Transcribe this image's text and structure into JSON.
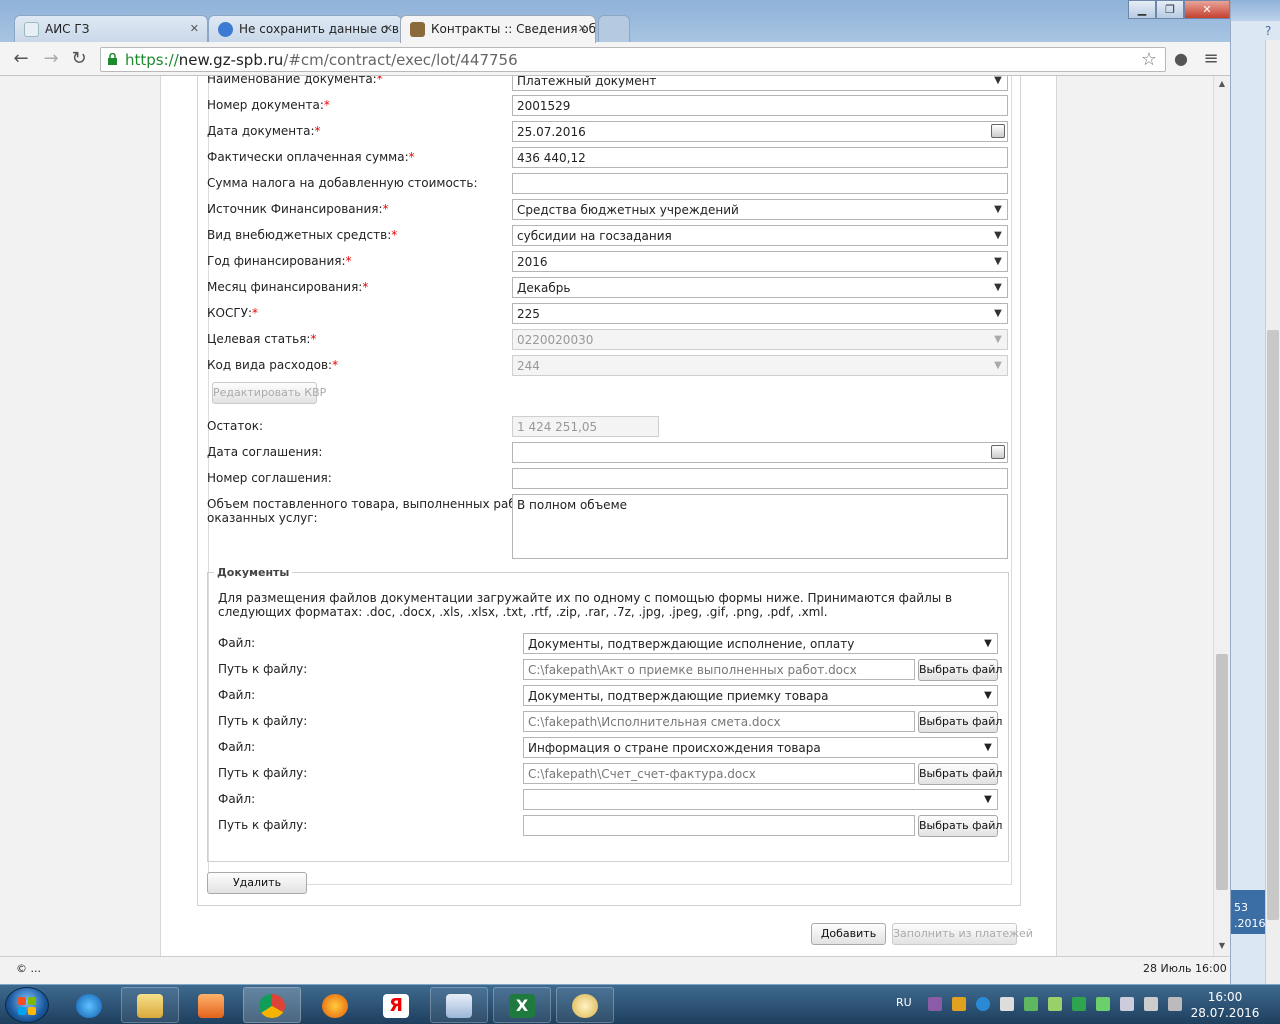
{
  "browser": {
    "tabs": [
      {
        "title": "АИС ГЗ",
        "active": false
      },
      {
        "title": "Не сохранить данные о выб",
        "active": false
      },
      {
        "title": "Контракты :: Сведения об и",
        "active": true
      }
    ],
    "url_secure": "https://",
    "url_host": "new.gz-spb.ru",
    "url_path": "/#cm/contract/exec/lot/447756"
  },
  "form": {
    "doc_name": {
      "label": "Наименование документа:",
      "value": "Платежный документ"
    },
    "doc_number": {
      "label": "Номер документа:",
      "value": "2001529"
    },
    "doc_date": {
      "label": "Дата документа:",
      "value": "25.07.2016"
    },
    "paid_sum": {
      "label": "Фактически оплаченная сумма:",
      "value": "436 440,12"
    },
    "vat_sum": {
      "label": "Сумма налога на добавленную стоимость:",
      "value": ""
    },
    "fin_source": {
      "label": "Источник Финансирования:",
      "value": "Средства бюджетных учреждений"
    },
    "extra_funds": {
      "label": "Вид внебюджетных средств:",
      "value": "субсидии на госзадания"
    },
    "fin_year": {
      "label": "Год финансирования:",
      "value": "2016"
    },
    "fin_month": {
      "label": "Месяц финансирования:",
      "value": "Декабрь"
    },
    "kosgu": {
      "label": "КОСГУ:",
      "value": "225"
    },
    "target_article": {
      "label": "Целевая статья:",
      "value": "0220020030"
    },
    "expense_code": {
      "label": "Код вида расходов:",
      "value": "244"
    },
    "edit_kvr": "Редактировать КВР",
    "remainder": {
      "label": "Остаток:",
      "value": "1 424 251,05"
    },
    "agreement_date": {
      "label": "Дата соглашения:",
      "value": ""
    },
    "agreement_number": {
      "label": "Номер соглашения:",
      "value": ""
    },
    "volume": {
      "label_line1": "Объем поставленного товара, выполненных работ,",
      "label_line2": "оказанных услуг:",
      "value": "В полном объеме"
    },
    "req_mark": "*"
  },
  "documents": {
    "legend": "Документы",
    "note": "Для размещения файлов документации загружайте их по одному с помощью формы ниже. Принимаются файлы в следующих форматах: .doc, .docx, .xls, .xlsx, .txt, .rtf, .zip, .rar, .7z, .jpg, .jpeg, .gif, .png, .pdf, .xml.",
    "file_label": "Файл:",
    "path_label": "Путь к файлу:",
    "choose_label": "Выбрать файл",
    "rows": [
      {
        "type": "Документы, подтверждающие исполнение, оплату",
        "path": "C:\\fakepath\\Акт о приемке выполненных работ.docx"
      },
      {
        "type": "Документы, подтверждающие приемку товара",
        "path": "C:\\fakepath\\Исполнительная смета.docx"
      },
      {
        "type": "Информация о стране происхождения товара",
        "path": "C:\\fakepath\\Счет_счет-фактура.docx"
      },
      {
        "type": "",
        "path": ""
      }
    ]
  },
  "actions": {
    "delete": "Удалить",
    "add": "Добавить",
    "fill_from_payments": "Заполнить из платежей"
  },
  "status": {
    "left": "© ...",
    "right": "28 Июль 16:00"
  },
  "sidewin": {
    "line1": "53",
    "line2": ".2016"
  },
  "taskbar": {
    "lang": "RU",
    "time": "16:00",
    "date": "28.07.2016"
  }
}
